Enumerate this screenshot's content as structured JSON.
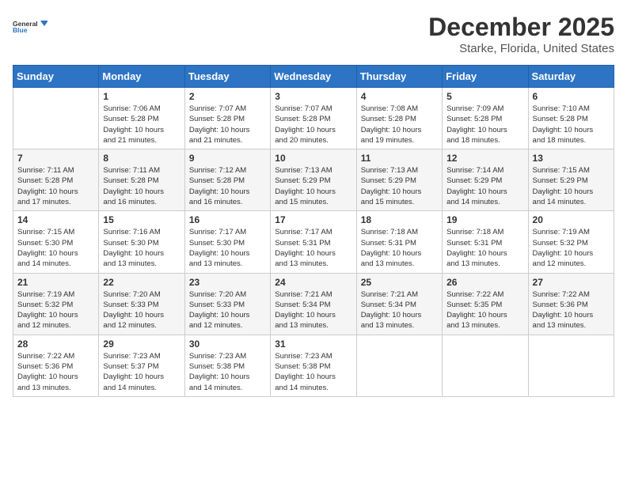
{
  "logo": {
    "line1": "General",
    "line2": "Blue"
  },
  "title": "December 2025",
  "location": "Starke, Florida, United States",
  "weekdays": [
    "Sunday",
    "Monday",
    "Tuesday",
    "Wednesday",
    "Thursday",
    "Friday",
    "Saturday"
  ],
  "weeks": [
    [
      {
        "day": "",
        "info": ""
      },
      {
        "day": "1",
        "info": "Sunrise: 7:06 AM\nSunset: 5:28 PM\nDaylight: 10 hours\nand 21 minutes."
      },
      {
        "day": "2",
        "info": "Sunrise: 7:07 AM\nSunset: 5:28 PM\nDaylight: 10 hours\nand 21 minutes."
      },
      {
        "day": "3",
        "info": "Sunrise: 7:07 AM\nSunset: 5:28 PM\nDaylight: 10 hours\nand 20 minutes."
      },
      {
        "day": "4",
        "info": "Sunrise: 7:08 AM\nSunset: 5:28 PM\nDaylight: 10 hours\nand 19 minutes."
      },
      {
        "day": "5",
        "info": "Sunrise: 7:09 AM\nSunset: 5:28 PM\nDaylight: 10 hours\nand 18 minutes."
      },
      {
        "day": "6",
        "info": "Sunrise: 7:10 AM\nSunset: 5:28 PM\nDaylight: 10 hours\nand 18 minutes."
      }
    ],
    [
      {
        "day": "7",
        "info": "Sunrise: 7:11 AM\nSunset: 5:28 PM\nDaylight: 10 hours\nand 17 minutes."
      },
      {
        "day": "8",
        "info": "Sunrise: 7:11 AM\nSunset: 5:28 PM\nDaylight: 10 hours\nand 16 minutes."
      },
      {
        "day": "9",
        "info": "Sunrise: 7:12 AM\nSunset: 5:28 PM\nDaylight: 10 hours\nand 16 minutes."
      },
      {
        "day": "10",
        "info": "Sunrise: 7:13 AM\nSunset: 5:29 PM\nDaylight: 10 hours\nand 15 minutes."
      },
      {
        "day": "11",
        "info": "Sunrise: 7:13 AM\nSunset: 5:29 PM\nDaylight: 10 hours\nand 15 minutes."
      },
      {
        "day": "12",
        "info": "Sunrise: 7:14 AM\nSunset: 5:29 PM\nDaylight: 10 hours\nand 14 minutes."
      },
      {
        "day": "13",
        "info": "Sunrise: 7:15 AM\nSunset: 5:29 PM\nDaylight: 10 hours\nand 14 minutes."
      }
    ],
    [
      {
        "day": "14",
        "info": "Sunrise: 7:15 AM\nSunset: 5:30 PM\nDaylight: 10 hours\nand 14 minutes."
      },
      {
        "day": "15",
        "info": "Sunrise: 7:16 AM\nSunset: 5:30 PM\nDaylight: 10 hours\nand 13 minutes."
      },
      {
        "day": "16",
        "info": "Sunrise: 7:17 AM\nSunset: 5:30 PM\nDaylight: 10 hours\nand 13 minutes."
      },
      {
        "day": "17",
        "info": "Sunrise: 7:17 AM\nSunset: 5:31 PM\nDaylight: 10 hours\nand 13 minutes."
      },
      {
        "day": "18",
        "info": "Sunrise: 7:18 AM\nSunset: 5:31 PM\nDaylight: 10 hours\nand 13 minutes."
      },
      {
        "day": "19",
        "info": "Sunrise: 7:18 AM\nSunset: 5:31 PM\nDaylight: 10 hours\nand 13 minutes."
      },
      {
        "day": "20",
        "info": "Sunrise: 7:19 AM\nSunset: 5:32 PM\nDaylight: 10 hours\nand 12 minutes."
      }
    ],
    [
      {
        "day": "21",
        "info": "Sunrise: 7:19 AM\nSunset: 5:32 PM\nDaylight: 10 hours\nand 12 minutes."
      },
      {
        "day": "22",
        "info": "Sunrise: 7:20 AM\nSunset: 5:33 PM\nDaylight: 10 hours\nand 12 minutes."
      },
      {
        "day": "23",
        "info": "Sunrise: 7:20 AM\nSunset: 5:33 PM\nDaylight: 10 hours\nand 12 minutes."
      },
      {
        "day": "24",
        "info": "Sunrise: 7:21 AM\nSunset: 5:34 PM\nDaylight: 10 hours\nand 13 minutes."
      },
      {
        "day": "25",
        "info": "Sunrise: 7:21 AM\nSunset: 5:34 PM\nDaylight: 10 hours\nand 13 minutes."
      },
      {
        "day": "26",
        "info": "Sunrise: 7:22 AM\nSunset: 5:35 PM\nDaylight: 10 hours\nand 13 minutes."
      },
      {
        "day": "27",
        "info": "Sunrise: 7:22 AM\nSunset: 5:36 PM\nDaylight: 10 hours\nand 13 minutes."
      }
    ],
    [
      {
        "day": "28",
        "info": "Sunrise: 7:22 AM\nSunset: 5:36 PM\nDaylight: 10 hours\nand 13 minutes."
      },
      {
        "day": "29",
        "info": "Sunrise: 7:23 AM\nSunset: 5:37 PM\nDaylight: 10 hours\nand 14 minutes."
      },
      {
        "day": "30",
        "info": "Sunrise: 7:23 AM\nSunset: 5:38 PM\nDaylight: 10 hours\nand 14 minutes."
      },
      {
        "day": "31",
        "info": "Sunrise: 7:23 AM\nSunset: 5:38 PM\nDaylight: 10 hours\nand 14 minutes."
      },
      {
        "day": "",
        "info": ""
      },
      {
        "day": "",
        "info": ""
      },
      {
        "day": "",
        "info": ""
      }
    ]
  ]
}
